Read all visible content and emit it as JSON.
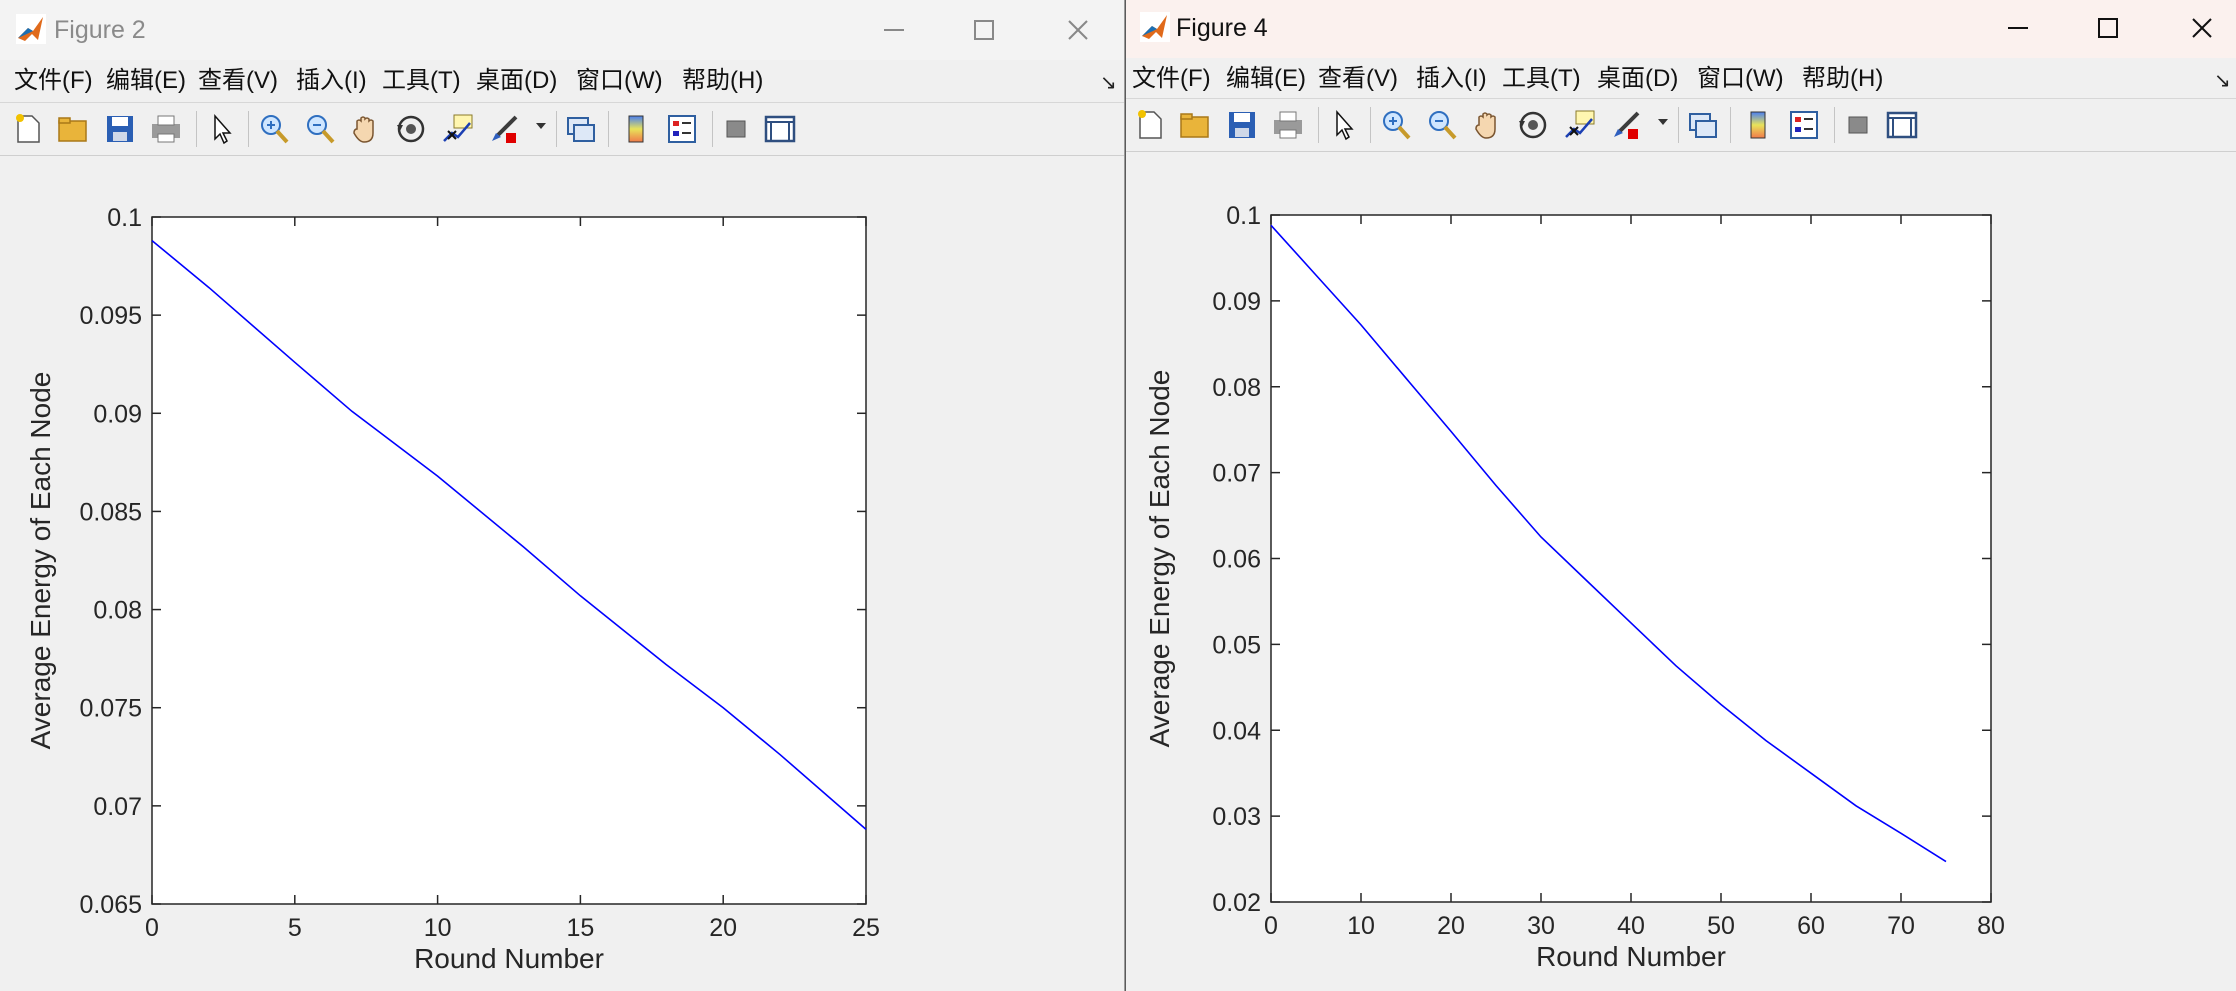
{
  "windows": [
    {
      "title": "Figure 2",
      "menus": [
        "文件(F)",
        "编辑(E)",
        "查看(V)",
        "插入(I)",
        "工具(T)",
        "桌面(D)",
        "窗口(W)",
        "帮助(H)"
      ]
    },
    {
      "title": "Figure 4",
      "menus": [
        "文件(F)",
        "编辑(E)",
        "查看(V)",
        "插入(I)",
        "工具(T)",
        "桌面(D)",
        "窗口(W)",
        "帮助(H)"
      ]
    }
  ],
  "toolbar_icons": [
    "new-file-icon",
    "open-folder-icon",
    "save-icon",
    "print-icon",
    "pointer-icon",
    "zoom-in-icon",
    "zoom-out-icon",
    "pan-hand-icon",
    "rotate-3d-icon",
    "data-tips-icon",
    "brush-icon",
    "link-plot-icon",
    "colorbar-icon",
    "legend-icon",
    "hide-plot-tools-icon",
    "show-plot-tools-icon"
  ],
  "colors": {
    "line": "#0000ff",
    "axes": "#262626",
    "accent_matlab": "#e06a1b"
  },
  "chart_data": [
    {
      "type": "line",
      "xlabel": "Round Number",
      "ylabel": "Average Energy of Each Node",
      "xlim": [
        0,
        25
      ],
      "ylim": [
        0.065,
        0.1
      ],
      "xticks": [
        0,
        5,
        10,
        15,
        20,
        25
      ],
      "xtick_labels": [
        "0",
        "5",
        "10",
        "15",
        "20",
        "25"
      ],
      "yticks": [
        0.065,
        0.07,
        0.075,
        0.08,
        0.085,
        0.09,
        0.095,
        0.1
      ],
      "ytick_labels": [
        "0.065",
        "0.07",
        "0.075",
        "0.08",
        "0.085",
        "0.09",
        "0.095",
        "0.1"
      ],
      "series": [
        {
          "x": [
            0,
            2,
            5,
            7,
            10,
            13,
            15,
            18,
            20,
            22,
            25
          ],
          "y": [
            0.0988,
            0.0964,
            0.0926,
            0.0901,
            0.0868,
            0.0832,
            0.0807,
            0.0772,
            0.075,
            0.0726,
            0.0688
          ]
        }
      ]
    },
    {
      "type": "line",
      "xlabel": "Round Number",
      "ylabel": "Average Energy of Each Node",
      "xlim": [
        0,
        80
      ],
      "ylim": [
        0.02,
        0.1
      ],
      "xticks": [
        0,
        10,
        20,
        30,
        40,
        50,
        60,
        70,
        80
      ],
      "xtick_labels": [
        "0",
        "10",
        "20",
        "30",
        "40",
        "50",
        "60",
        "70",
        "80"
      ],
      "yticks": [
        0.02,
        0.03,
        0.04,
        0.05,
        0.06,
        0.07,
        0.08,
        0.09,
        0.1
      ],
      "ytick_labels": [
        "0.02",
        "0.03",
        "0.04",
        "0.05",
        "0.06",
        "0.07",
        "0.08",
        "0.09",
        "0.1"
      ],
      "series": [
        {
          "x": [
            0,
            5,
            10,
            15,
            20,
            25,
            30,
            35,
            40,
            45,
            50,
            55,
            60,
            65,
            70,
            75
          ],
          "y": [
            0.0988,
            0.093,
            0.0872,
            0.081,
            0.0748,
            0.0685,
            0.0625,
            0.0575,
            0.0525,
            0.0475,
            0.043,
            0.0388,
            0.035,
            0.0312,
            0.028,
            0.0247
          ]
        }
      ]
    }
  ]
}
